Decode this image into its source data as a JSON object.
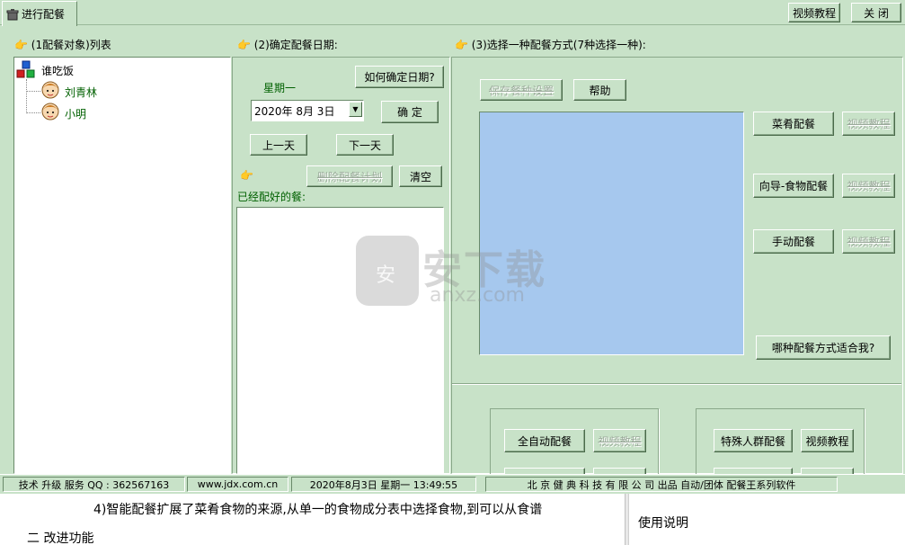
{
  "tab": {
    "label": "进行配餐"
  },
  "toolbar": {
    "video_tutorial": "视频教程",
    "close": "关 闭"
  },
  "section1": {
    "title": "(1配餐对象)列表",
    "tree_root": "谁吃饭",
    "people": [
      "刘青林",
      "小明"
    ]
  },
  "section2": {
    "title": "(2)确定配餐日期:",
    "how_button": "如何确定日期?",
    "weekday": "星期一",
    "date_value": "2020年 8月 3日",
    "confirm_button": "确 定",
    "prev_day_button": "上一天",
    "next_day_button": "下一天",
    "delete_plan_button": "删除配餐计划",
    "clear_button": "清空",
    "done_meals_label": "已经配好的餐:"
  },
  "section3": {
    "title": "(3)选择一种配餐方式(7种选择一种):",
    "save_settings_button": "保存餐种设置",
    "help_button": "帮助",
    "dish_button": "菜肴配餐",
    "wizard_button": "向导-食物配餐",
    "manual_button": "手动配餐",
    "video_button": "视频教程",
    "which_button": "哪种配餐方式适合我?",
    "auto_button": "全自动配餐",
    "special_button": "特殊人群配餐",
    "special_video_button": "视频教程"
  },
  "status": {
    "support": "技术 升级 服务 QQ : 362567163",
    "website": "www.jdx.com.cn",
    "datetime": "2020年8月3日  星期一 13:49:55",
    "company": "北 京 健 典 科 技 有 限 公 司  出品 自动/团体 配餐王系列软件"
  },
  "document": {
    "line1": "4)智能配餐扩展了菜肴食物的来源,从单一的食物成分表中选择食物,到可以从食谱",
    "line2": "二 改进功能",
    "right_panel": "使用说明"
  },
  "watermark": {
    "text": "安下载",
    "subtext": "anxz.com"
  },
  "colors": {
    "background": "#c8e2c8",
    "preview_box": "#a6c8ee",
    "white": "#ffffff"
  }
}
